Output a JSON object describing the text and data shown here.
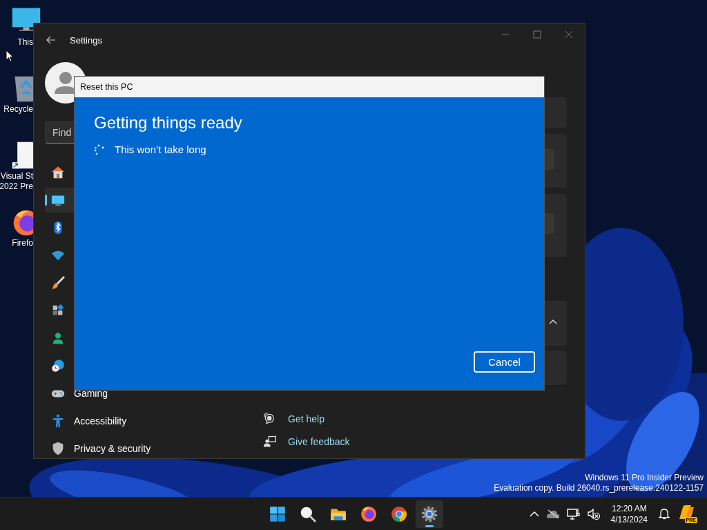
{
  "desktop": {
    "icons": [
      {
        "kind": "computer",
        "lines": [
          "This"
        ]
      },
      {
        "kind": "recycle-bin",
        "lines": [
          "Recycle"
        ]
      },
      {
        "kind": "document",
        "lines": [
          "Visual St",
          "2022 Pre"
        ]
      },
      {
        "kind": "fox",
        "lines": [
          "Firefo"
        ]
      }
    ],
    "system_text": [
      "Windows 11 Pro Insider Preview",
      "Evaluation copy. Build 26040.rs_prerelease.240122-1157"
    ]
  },
  "settings": {
    "title": "Settings",
    "search": {
      "placeholder": "Find"
    },
    "nav": [
      {
        "kind": "home",
        "selected": false
      },
      {
        "kind": "system",
        "selected": true
      },
      {
        "kind": "bluetooth",
        "selected": false
      },
      {
        "kind": "network",
        "selected": false
      },
      {
        "kind": "personalization",
        "selected": false
      },
      {
        "kind": "apps",
        "selected": false
      },
      {
        "kind": "accounts",
        "selected": false
      },
      {
        "kind": "time",
        "selected": false
      },
      {
        "kind": "gaming",
        "label": "Gaming",
        "selected": false
      },
      {
        "kind": "accessibility",
        "label": "Accessibility",
        "selected": false
      },
      {
        "kind": "privacy",
        "label": "Privacy & security",
        "selected": false
      }
    ],
    "links": [
      {
        "kind": "help",
        "label": "Get help"
      },
      {
        "kind": "feedback",
        "label": "Give feedback"
      }
    ]
  },
  "dialog": {
    "title": "Reset this PC",
    "heading": "Getting things ready",
    "status": "This won’t take long",
    "buttons": [
      "Cancel"
    ]
  },
  "taskbar": {
    "apps": [
      {
        "kind": "start",
        "active": false
      },
      {
        "kind": "search",
        "active": false
      },
      {
        "kind": "folder",
        "active": false
      },
      {
        "kind": "fox",
        "active": false
      },
      {
        "kind": "chrome",
        "active": false
      },
      {
        "kind": "gear",
        "active": true
      }
    ],
    "tray": {
      "time": "12:20 AM",
      "date": "4/13/2024",
      "badge": "PRE"
    }
  }
}
